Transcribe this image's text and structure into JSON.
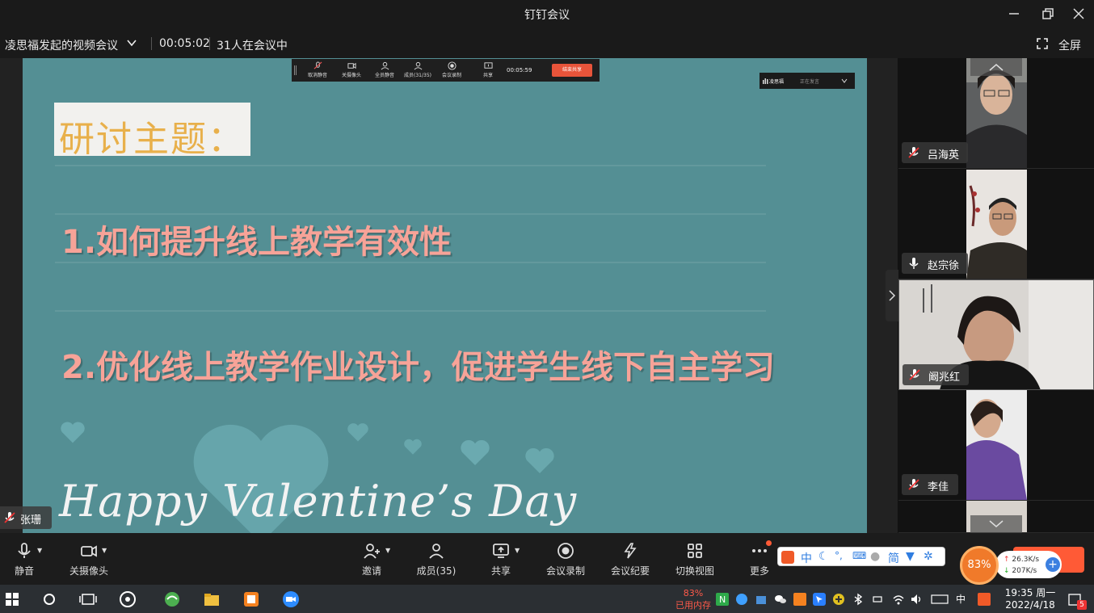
{
  "window": {
    "title": "钉钉会议"
  },
  "info": {
    "meeting_title": "凌思福发起的视频会议",
    "elapsed": "00:05:02",
    "participants_count": "31人在会议中",
    "fullscreen": "全屏"
  },
  "share_toolbar": {
    "items": [
      "取消静音",
      "关摄像头",
      "全员静音",
      "成员(31/35)",
      "会议录制",
      "共享"
    ],
    "time": "00:05:59",
    "stop": "结束共享",
    "speaking_name": "凌思福",
    "speaking_status": "正在发言"
  },
  "slide": {
    "title": "研讨主题：",
    "points": [
      "1.如何提升线上教学有效性",
      "2.优化线上教学作业设计，促进学生线下自主学习"
    ],
    "script": "Happy Valentine’s Day"
  },
  "self": {
    "name": "张珊"
  },
  "participants": [
    {
      "name": "吕海英",
      "muted": true
    },
    {
      "name": "赵宗徐",
      "muted": false
    },
    {
      "name": "阚兆红",
      "muted": true
    },
    {
      "name": "李佳",
      "muted": true
    }
  ],
  "controls": {
    "mute": "静音",
    "camera": "关摄像头",
    "invite": "邀请",
    "members": "成员(35)",
    "share": "共享",
    "record": "会议录制",
    "minutes": "会议纪要",
    "view": "切换视图",
    "more": "更多"
  },
  "ime": {
    "chars": [
      "中",
      "简"
    ]
  },
  "perf": {
    "percent": "83%",
    "up": "26.3K/s",
    "down": "207K/s"
  },
  "taskbar": {
    "mem_percent": "83%",
    "mem_label": "已用内存",
    "ime_lang": "中",
    "time": "19:35 周一",
    "date": "2022/4/18",
    "notif_count": "5"
  },
  "colors": {
    "slide_bg": "#548f94",
    "slide_title": "#e8b04b",
    "slide_points": "#f7a398",
    "stop_share": "#e8543a",
    "accent_orange": "#ff5a36"
  }
}
